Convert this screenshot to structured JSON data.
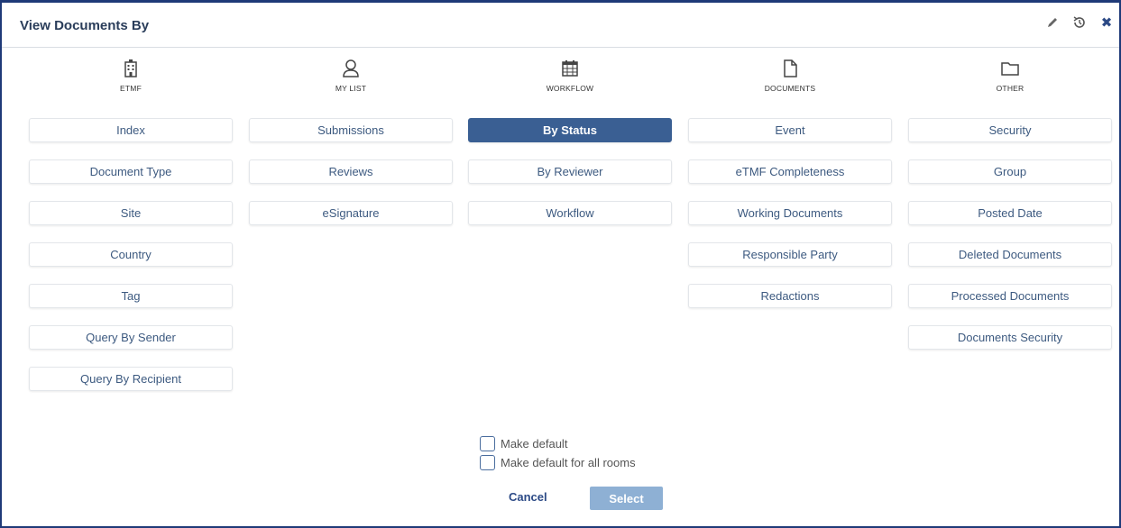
{
  "dialog": {
    "title": "View Documents By",
    "header_icons": [
      "pencil-icon",
      "history-icon",
      "close-icon"
    ],
    "close_glyph": "✖"
  },
  "columns": [
    {
      "label": "ETMF",
      "icon": "building-icon",
      "options": [
        "Index",
        "Document Type",
        "Site",
        "Country",
        "Tag",
        "Query By Sender",
        "Query By Recipient"
      ]
    },
    {
      "label": "MY LIST",
      "icon": "user-icon",
      "options": [
        "Submissions",
        "Reviews",
        "eSignature"
      ]
    },
    {
      "label": "WORKFLOW",
      "icon": "calendar-icon",
      "options": [
        "By Status",
        "By Reviewer",
        "Workflow"
      ]
    },
    {
      "label": "DOCUMENTS",
      "icon": "document-icon",
      "options": [
        "Event",
        "eTMF Completeness",
        "Working Documents",
        "Responsible Party",
        "Redactions"
      ]
    },
    {
      "label": "OTHER",
      "icon": "folder-icon",
      "options": [
        "Security",
        "Group",
        "Posted Date",
        "Deleted Documents",
        "Processed Documents",
        "Documents Security"
      ]
    }
  ],
  "selected_option": "By Status",
  "footer": {
    "make_default": "Make default",
    "make_default_all": "Make default for all rooms",
    "cancel": "Cancel",
    "select": "Select"
  },
  "colors": {
    "accent": "#3a5f93",
    "border": "#1f3a78",
    "select_button": "#8eb0d4"
  }
}
